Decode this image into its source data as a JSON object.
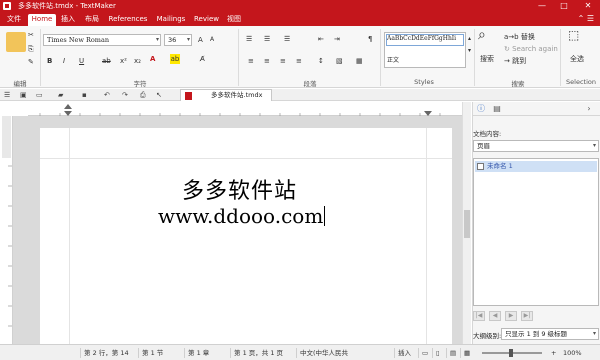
{
  "window": {
    "title": "多多软件站.tmdx - TextMaker",
    "min": "—",
    "max": "□",
    "close": "✕"
  },
  "tabs": [
    {
      "label": "文件"
    },
    {
      "label": "Home"
    },
    {
      "label": "插入"
    },
    {
      "label": "布局"
    },
    {
      "label": "References"
    },
    {
      "label": "Mailings"
    },
    {
      "label": "Review"
    },
    {
      "label": "视图"
    }
  ],
  "ribbon": {
    "font_name": "Times New Roman",
    "font_size": "36",
    "bold": "B",
    "italic": "I",
    "underline": "U",
    "groups": {
      "edit": "编辑",
      "char": "字符",
      "para": "段落",
      "styles": "Styles",
      "search": "搜索",
      "selection": "Selection"
    },
    "style_preview": "AaBbCcDdEeFfGgHhIi",
    "style_normal": "正文",
    "search_label": "搜索",
    "replace_label": "替换",
    "search_again": "Search again",
    "goto_label": "跳到",
    "select_all": "全选"
  },
  "doc_tab": {
    "title": "多多软件站.tmdx"
  },
  "document": {
    "line1": "多多软件站",
    "line2": "www.ddooo.com"
  },
  "sidepanel": {
    "contents_label": "文档内容:",
    "contents_value": "页眉",
    "item": "未命名 1",
    "level_label": "大纲级别:",
    "level_value": "只显示 1 到 9 级标题"
  },
  "statusbar": {
    "line_col": "第 2 行，第 14",
    "section": "第 1 节",
    "chapter": "第 1 章",
    "page": "第 1 页，共 1 页",
    "language": "中文(中华人民共",
    "mode": "插入",
    "zoom": "100%"
  }
}
